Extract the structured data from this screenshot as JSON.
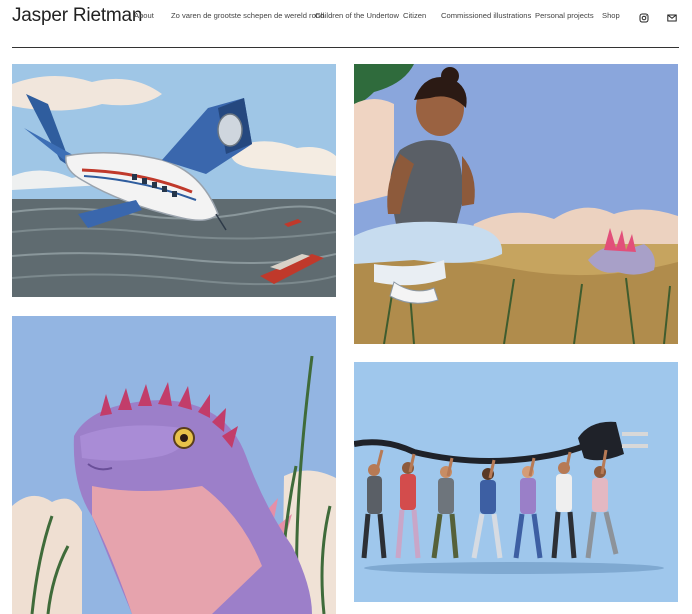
{
  "site": {
    "title": "Jasper Rietman"
  },
  "nav": {
    "items": [
      {
        "label": "About"
      },
      {
        "label": "Zo varen de grootste schepen de wereld rond"
      },
      {
        "label": "Children of the Undertow"
      },
      {
        "label": "Citizen"
      },
      {
        "label": "Commissioned illustrations"
      },
      {
        "label": "Personal projects"
      },
      {
        "label": "Shop"
      }
    ],
    "icons": [
      "instagram-icon",
      "mail-icon"
    ]
  },
  "gallery": {
    "tiles": [
      {
        "subject": "airplane-over-sea-illustration"
      },
      {
        "subject": "girl-with-dinosaur-illustration"
      },
      {
        "subject": "iguana-illustration"
      },
      {
        "subject": "people-carrying-plug-illustration"
      }
    ]
  },
  "colors": {
    "text": "#222222",
    "rule": "#333333",
    "background": "#ffffff"
  }
}
